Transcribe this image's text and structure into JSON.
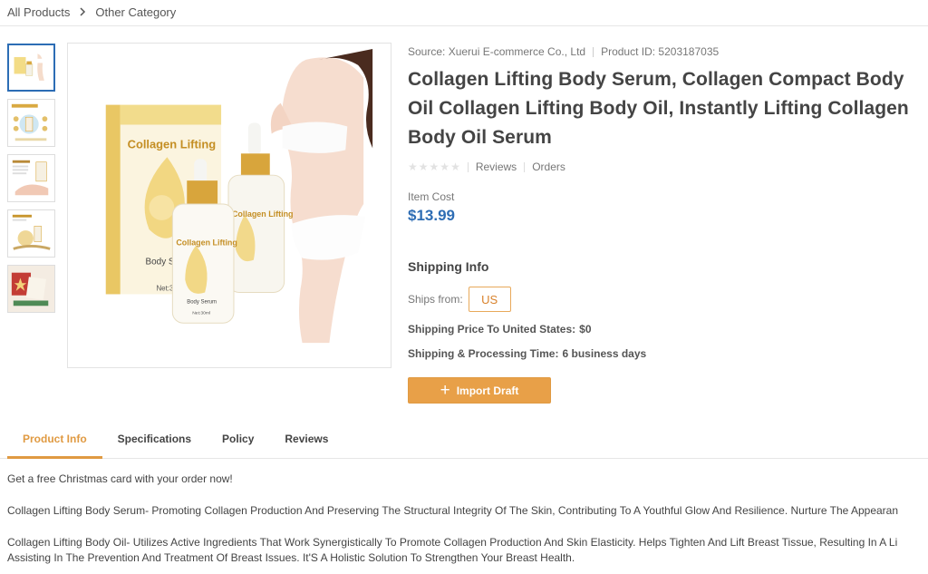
{
  "breadcrumb": {
    "root": "All Products",
    "current": "Other Category"
  },
  "product": {
    "source": "Source: Xuerui E-commerce Co., Ltd",
    "product_id": "Product ID: 5203187035",
    "title": "Collagen Lifting Body Serum, Collagen Compact Body Oil Collagen Lifting Body Oil, Instantly Lifting Collagen Body Oil Serum",
    "rating": 0,
    "reviews_label": "Reviews",
    "orders_label": "Orders",
    "cost_label": "Item Cost",
    "price": "$13.99",
    "image_text": {
      "box_title": "Collagen Lifting",
      "box_sub": "Body S",
      "box_net": "Net:3",
      "bottle_title": "Collagen Lifting",
      "bottle_sub": "Body Serum",
      "bottle_net": "Net:30ml"
    }
  },
  "shipping": {
    "heading": "Shipping Info",
    "ships_from_label": "Ships from:",
    "ships_from_value": "US",
    "price_label": "Shipping Price To United States:",
    "price_value": "$0",
    "time_label": "Shipping & Processing Time:",
    "time_value": "6 business days"
  },
  "actions": {
    "import_label": "Import Draft"
  },
  "tabs": [
    "Product Info",
    "Specifications",
    "Policy",
    "Reviews"
  ],
  "description": {
    "p1": "Get a free Christmas card with your order now!",
    "p2": "Collagen Lifting Body Serum- Promoting Collagen Production And Preserving The Structural Integrity Of The Skin, Contributing To A Youthful Glow And Resilience. Nurture The Appearan",
    "p3a": "Collagen Lifting Body Oil- Utilizes Active Ingredients That Work Synergistically To Promote Collagen Production And Skin Elasticity. Helps Tighten And Lift Breast Tissue, Resulting In A Li",
    "p3b": "Assisting In The Prevention And Treatment Of Breast Issues. It'S A Holistic Solution To Strengthen Your Breast Health."
  },
  "colors": {
    "accent": "#e09a42",
    "price": "#2e6db4",
    "active_thumb": "#2c6db5"
  }
}
